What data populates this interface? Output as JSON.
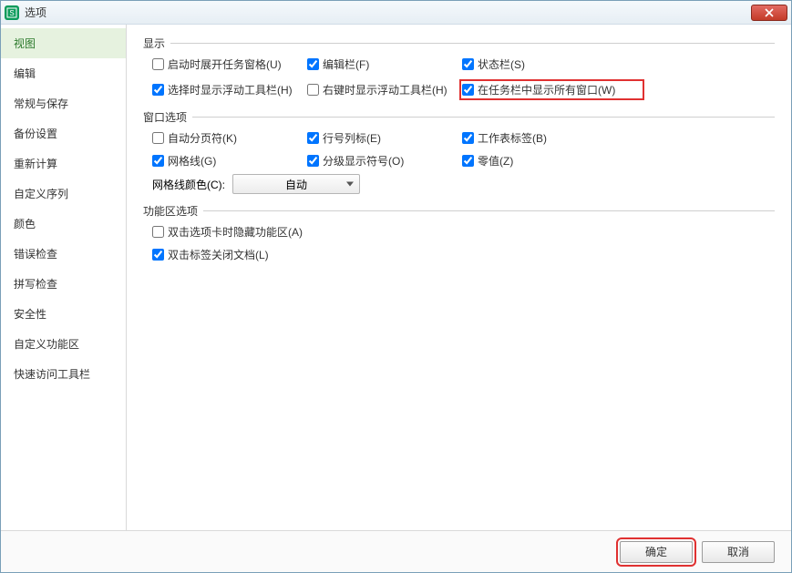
{
  "titlebar": {
    "title": "选项"
  },
  "sidebar": {
    "items": [
      "视图",
      "编辑",
      "常规与保存",
      "备份设置",
      "重新计算",
      "自定义序列",
      "颜色",
      "错误检查",
      "拼写检查",
      "安全性",
      "自定义功能区",
      "快速访问工具栏"
    ],
    "active_index": 0
  },
  "groups": {
    "display": {
      "title": "显示",
      "options": [
        {
          "label": "启动时展开任务窗格(U)",
          "checked": false
        },
        {
          "label": "编辑栏(F)",
          "checked": true
        },
        {
          "label": "状态栏(S)",
          "checked": true
        },
        {
          "label": "选择时显示浮动工具栏(H)",
          "checked": true
        },
        {
          "label": "右键时显示浮动工具栏(H)",
          "checked": false
        },
        {
          "label": "在任务栏中显示所有窗口(W)",
          "checked": true,
          "highlight": true
        }
      ]
    },
    "window": {
      "title": "窗口选项",
      "options": [
        {
          "label": "自动分页符(K)",
          "checked": false
        },
        {
          "label": "行号列标(E)",
          "checked": true
        },
        {
          "label": "工作表标签(B)",
          "checked": true
        },
        {
          "label": "网格线(G)",
          "checked": true
        },
        {
          "label": "分级显示符号(O)",
          "checked": true
        },
        {
          "label": "零值(Z)",
          "checked": true
        }
      ],
      "grid_color_label": "网格线颜色(C):",
      "grid_color_value": "自动"
    },
    "ribbon": {
      "title": "功能区选项",
      "options": [
        {
          "label": "双击选项卡时隐藏功能区(A)",
          "checked": false
        },
        {
          "label": "双击标签关闭文档(L)",
          "checked": true
        }
      ]
    }
  },
  "footer": {
    "ok": "确定",
    "cancel": "取消"
  }
}
